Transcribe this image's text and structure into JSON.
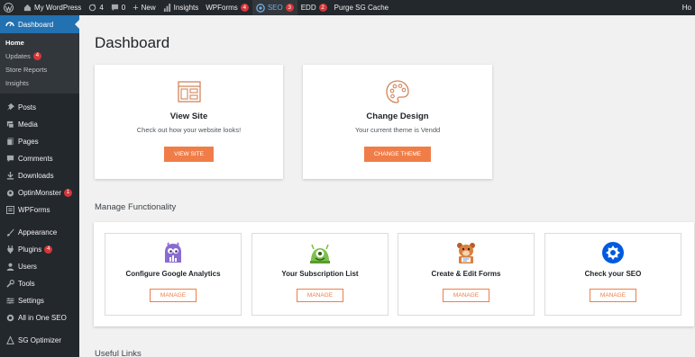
{
  "adminbar": {
    "site_name": "My WordPress",
    "updates_count": "4",
    "comments_count": "0",
    "new_label": "New",
    "insights_label": "Insights",
    "wpforms_label": "WPForms",
    "wpforms_badge": "4",
    "seo_label": "SEO",
    "seo_badge": "3",
    "edd_label": "EDD",
    "edd_badge": "2",
    "purge_label": "Purge SG Cache",
    "howdy_label": "Ho"
  },
  "sidebar": {
    "dashboard_label": "Dashboard",
    "submenu": [
      {
        "label": "Home"
      },
      {
        "label": "Updates",
        "badge": "4"
      },
      {
        "label": "Store Reports"
      },
      {
        "label": "Insights"
      }
    ],
    "items": [
      {
        "label": "Posts"
      },
      {
        "label": "Media"
      },
      {
        "label": "Pages"
      },
      {
        "label": "Comments"
      },
      {
        "label": "Downloads"
      },
      {
        "label": "OptinMonster",
        "badge": "1"
      },
      {
        "label": "WPForms"
      },
      {
        "label": "Appearance"
      },
      {
        "label": "Plugins",
        "badge": "4"
      },
      {
        "label": "Users"
      },
      {
        "label": "Tools"
      },
      {
        "label": "Settings"
      },
      {
        "label": "All in One SEO"
      },
      {
        "label": "SG Optimizer"
      }
    ]
  },
  "main": {
    "title": "Dashboard",
    "cards": [
      {
        "title": "View Site",
        "desc": "Check out how your website looks!",
        "button": "VIEW SITE"
      },
      {
        "title": "Change Design",
        "desc": "Your current theme is Vendd",
        "button": "CHANGE THEME"
      }
    ],
    "manage_heading": "Manage Functionality",
    "functions": [
      {
        "title": "Configure Google Analytics",
        "button": "MANAGE"
      },
      {
        "title": "Your Subscription List",
        "button": "MANAGE"
      },
      {
        "title": "Create & Edit Forms",
        "button": "MANAGE"
      },
      {
        "title": "Check your SEO",
        "button": "MANAGE"
      }
    ],
    "useful_heading": "Useful Links"
  },
  "colors": {
    "admin_dark": "#23282d",
    "accent_blue": "#2271b1",
    "accent_orange": "#f07d48",
    "badge_red": "#d63638"
  }
}
